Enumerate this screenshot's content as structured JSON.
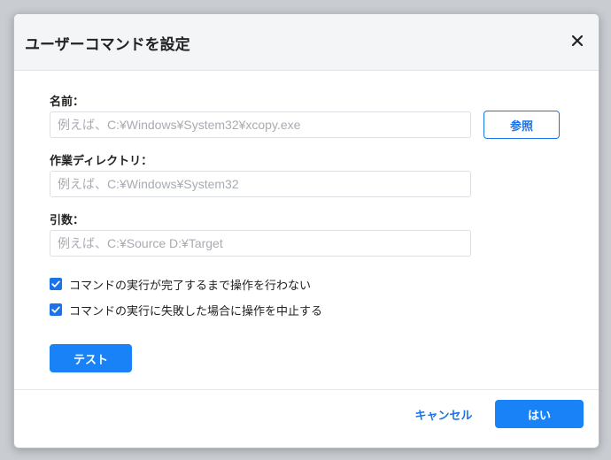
{
  "dialog": {
    "title": "ユーザーコマンドを設定",
    "close_icon": "close-icon"
  },
  "form": {
    "name": {
      "label": "名前：",
      "value": "",
      "placeholder": "例えば、C:¥Windows¥System32¥xcopy.exe"
    },
    "browse_label": "参照",
    "workdir": {
      "label": "作業ディレクトリ：",
      "value": "",
      "placeholder": "例えば、C:¥Windows¥System32"
    },
    "args": {
      "label": "引数：",
      "value": "",
      "placeholder": "例えば、C:¥Source D:¥Target"
    },
    "options": [
      {
        "label": "コマンドの実行が完了するまで操作を行わない",
        "checked": true
      },
      {
        "label": "コマンドの実行に失敗した場合に操作を中止する",
        "checked": true
      }
    ],
    "test_label": "テスト"
  },
  "footer": {
    "cancel_label": "キャンセル",
    "ok_label": "はい"
  },
  "colors": {
    "accent": "#1a73e8",
    "primary_button": "#1a82f7",
    "header_bg": "#f4f5f7"
  }
}
